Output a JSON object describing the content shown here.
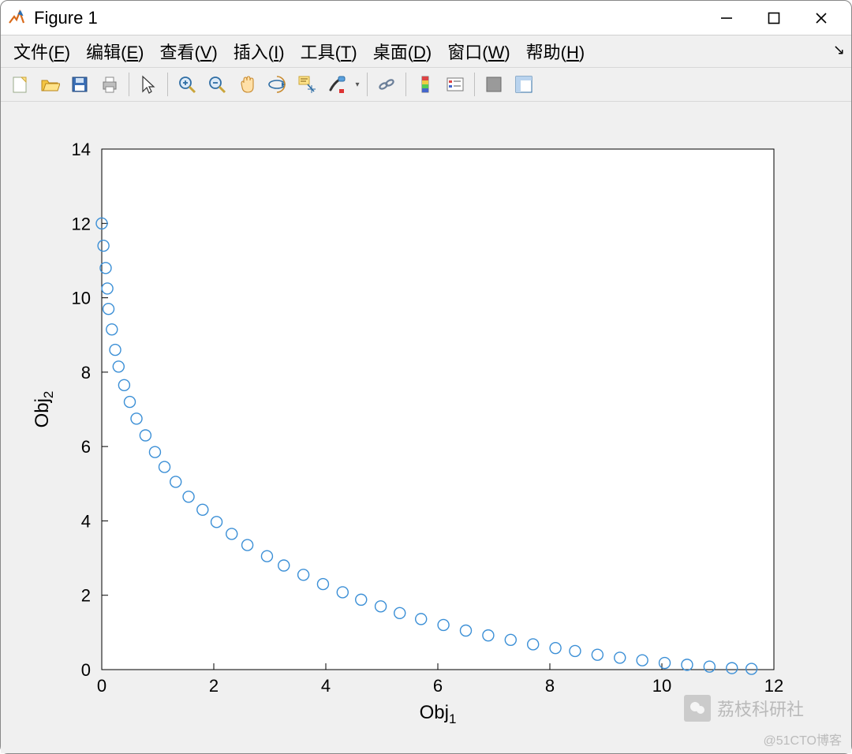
{
  "window": {
    "title": "Figure 1"
  },
  "menu": {
    "file": "文件(F)",
    "edit": "编辑(E)",
    "view": "查看(V)",
    "insert": "插入(I)",
    "tools": "工具(T)",
    "desktop": "桌面(D)",
    "window_m": "窗口(W)",
    "help": "帮助(H)"
  },
  "toolbar_icons": {
    "new": "new-figure-icon",
    "open": "open-icon",
    "save": "save-icon",
    "print": "print-icon",
    "pointer": "pointer-icon",
    "zoom_in": "zoom-in-icon",
    "zoom_out": "zoom-out-icon",
    "pan": "pan-icon",
    "rotate": "rotate3d-icon",
    "datatip": "data-cursor-icon",
    "brush": "brush-icon",
    "link": "link-icon",
    "colorbar": "colorbar-icon",
    "legend": "legend-icon",
    "hide": "hide-plot-tools-icon",
    "show": "show-plot-tools-icon"
  },
  "watermarks": {
    "w1": "荔枝科研社",
    "w2": "@51CTO博客"
  },
  "chart_data": {
    "type": "scatter",
    "xlabel": "Obj",
    "xlabel_sub": "1",
    "ylabel": "Obj",
    "ylabel_sub": "2",
    "xlim": [
      0,
      12
    ],
    "ylim": [
      0,
      14
    ],
    "xticks": [
      0,
      2,
      4,
      6,
      8,
      10,
      12
    ],
    "yticks": [
      0,
      2,
      4,
      6,
      8,
      10,
      12,
      14
    ],
    "x": [
      0.0,
      0.03,
      0.07,
      0.1,
      0.12,
      0.18,
      0.24,
      0.3,
      0.4,
      0.5,
      0.62,
      0.78,
      0.95,
      1.12,
      1.32,
      1.55,
      1.8,
      2.05,
      2.32,
      2.6,
      2.95,
      3.25,
      3.6,
      3.95,
      4.3,
      4.63,
      4.98,
      5.32,
      5.7,
      6.1,
      6.5,
      6.9,
      7.3,
      7.7,
      8.1,
      8.45,
      8.85,
      9.25,
      9.65,
      10.05,
      10.45,
      10.85,
      11.25,
      11.6
    ],
    "y": [
      12.0,
      11.4,
      10.8,
      10.25,
      9.7,
      9.15,
      8.6,
      8.15,
      7.65,
      7.2,
      6.75,
      6.3,
      5.85,
      5.45,
      5.05,
      4.65,
      4.3,
      3.97,
      3.65,
      3.35,
      3.05,
      2.8,
      2.55,
      2.3,
      2.08,
      1.88,
      1.7,
      1.52,
      1.36,
      1.2,
      1.05,
      0.92,
      0.8,
      0.68,
      0.58,
      0.5,
      0.4,
      0.32,
      0.25,
      0.18,
      0.13,
      0.08,
      0.04,
      0.02
    ],
    "marker_color": "#3b8fd6"
  }
}
